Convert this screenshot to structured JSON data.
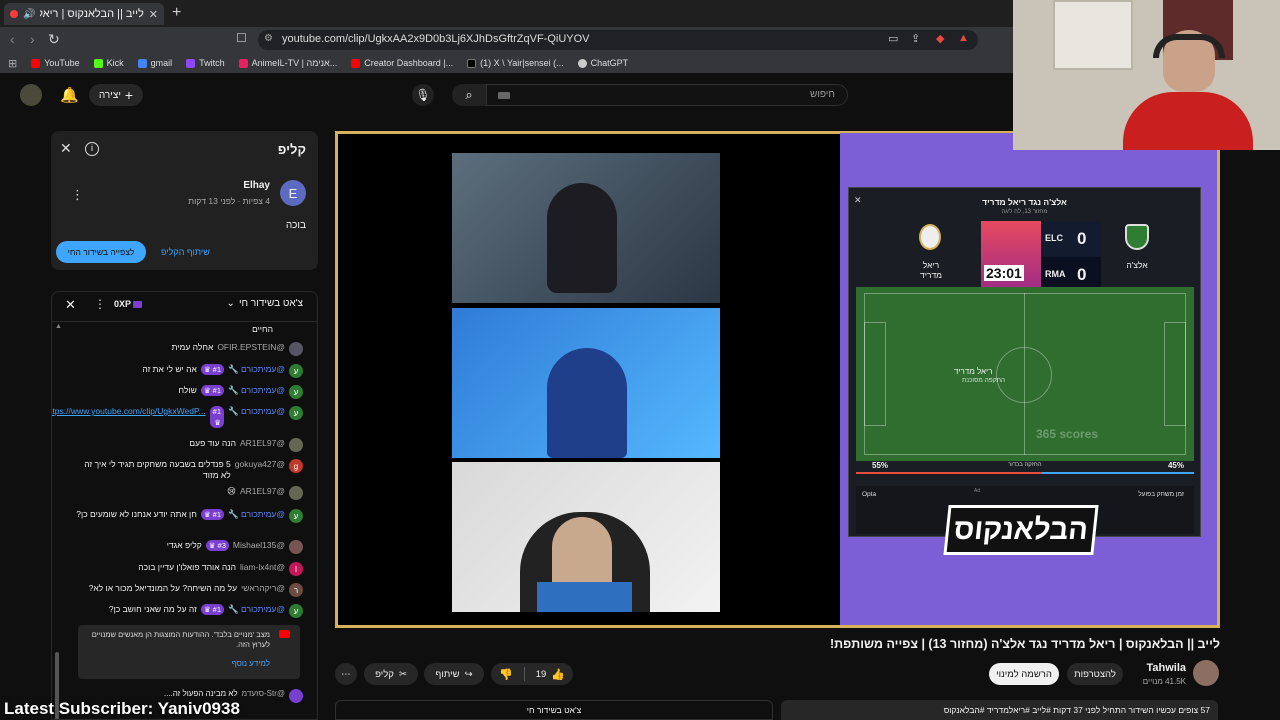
{
  "browser": {
    "tab_title": "לייב || הבלאנקוס | ריאל מדריד",
    "url": "youtube.com/clip/UgkxAA2x9D0b3Lj6XJhDsGftrZqVF-QiUYOV",
    "bookmarks": [
      "YouTube",
      "Kick",
      "gmail",
      "Twitch",
      "AnimeIL-TV | אנימה...",
      "Creator Dashboard |...",
      "(1) X \\ Yair|sensei (...",
      "ChatGPT"
    ]
  },
  "youtube": {
    "create_label": "יצירה",
    "search_placeholder": "חיפוש"
  },
  "clip_panel": {
    "title": "קליפ",
    "author": "Elhay",
    "author_initial": "E",
    "meta": "4 צפיות · לפני 13 דקות",
    "description": "בוכה",
    "share_label": "שיתוף הקליפ",
    "watch_live_label": "לצפייה בשידור החי"
  },
  "chat": {
    "header": "צ'אט בשידור חי",
    "xp": "0XP",
    "truncated_line": "החיים",
    "messages": [
      {
        "user": "@OFIR.EPSTEIN",
        "text": "אחלה עמית",
        "mod": false,
        "badge": "",
        "initial": "",
        "color": "#556"
      },
      {
        "user": "@עמיתכורם",
        "text": "אה יש לי את זה",
        "mod": true,
        "badge": "#1",
        "initial": "ע",
        "color": "#2e7d32"
      },
      {
        "user": "@עמיתכורם",
        "text": "שולח",
        "mod": true,
        "badge": "#1",
        "initial": "ע",
        "color": "#2e7d32"
      },
      {
        "user": "@עמיתכורם",
        "text": "https://www.youtube.com/clip/UgkxWedP...",
        "mod": true,
        "badge": "#1",
        "initial": "ע",
        "color": "#2e7d32"
      },
      {
        "user": "@AR1EL97",
        "text": "הנה עוד פעם",
        "mod": false,
        "badge": "",
        "initial": "",
        "color": "#665"
      },
      {
        "user": "@gokuya427",
        "text": "5 פנדלים בשבעה משחקים תגיד לי איך זה לא מזוד",
        "mod": false,
        "badge": "",
        "initial": "g",
        "color": "#c0392b"
      },
      {
        "user": "@AR1EL97",
        "text": "😢",
        "mod": false,
        "badge": "",
        "initial": "",
        "color": "#665"
      },
      {
        "user": "@עמיתכורם",
        "text": "חן אתה יודע אנחנו לא שומעים כן?",
        "mod": true,
        "badge": "#1",
        "initial": "ע",
        "color": "#2e7d32"
      },
      {
        "user": "@Mishael135",
        "text": "קליפ אגדי",
        "mod": false,
        "badge": "#3",
        "initial": "",
        "color": "#755"
      },
      {
        "user": "@liam-lx4nt",
        "text": "הנה אוהד פואלו'ן עדיין בוכה",
        "mod": false,
        "badge": "",
        "initial": "l",
        "color": "#c2185b"
      },
      {
        "user": "@ריקהראשי",
        "text": "על מה השיחה? על המונדיאל מכור או לא?",
        "mod": false,
        "badge": "",
        "initial": "ר",
        "color": "#6d4c41"
      },
      {
        "user": "@עמיתכורם",
        "text": "זה על מה שאני חושב כן?",
        "mod": true,
        "badge": "#1",
        "initial": "ע",
        "color": "#2e7d32"
      }
    ],
    "notice_text": "מצב 'מנויים בלבד'. ההודעות המוצגות הן מאנשים שמנויים לערוץ הזה.",
    "notice_link": "למידע נוסף",
    "last_line_user": "@Str-סזעדמ",
    "last_line_text": "לא מבינה הפעול זה...."
  },
  "match": {
    "title": "אלצ'ה נגד ריאל מדריד",
    "subtitle": "מחזור 13, לה ליגה",
    "home_team": "ריאל מדריד",
    "away_team": "אלצ'ה",
    "home_abbr": "RMA",
    "away_abbr": "ELC",
    "score_elc": "0",
    "score_rma": "0",
    "clock": "23:01",
    "possession_team": "ריאל מדריד",
    "possession_label": "התקפה מסוכנת",
    "poss_left": "55%",
    "poss_right": "45%",
    "poss_label": "החזקה בכדור",
    "watermark": "365 scores",
    "bottom_label": "זמן משחק בפועל",
    "opta": "Opta",
    "ad": "Ad",
    "logo_text": "הבלאנקוס"
  },
  "video": {
    "title": "לייב || הבלאנקוס | ריאל מדריד נגד אלצ'ה (מחזור 13) | צפייה משותפת!",
    "channel": "Tahwila",
    "subs": "41.5K מנויים",
    "join_label": "להצטרפות",
    "subscribed_label": "הרשמה למינוי",
    "likes": "19",
    "share_label": "שיתוף",
    "clip_label": "קליפ",
    "stats_line": "57 צופים עכשיו  השידור התחיל לפני 37 דקות  #לייב #ריאלמדריד #הבלאנקוס",
    "live_chat_btn": "צ'אט בשידור חי"
  },
  "overlay": {
    "latest_subscriber": "Latest Subscriber: Yaniv0938"
  }
}
